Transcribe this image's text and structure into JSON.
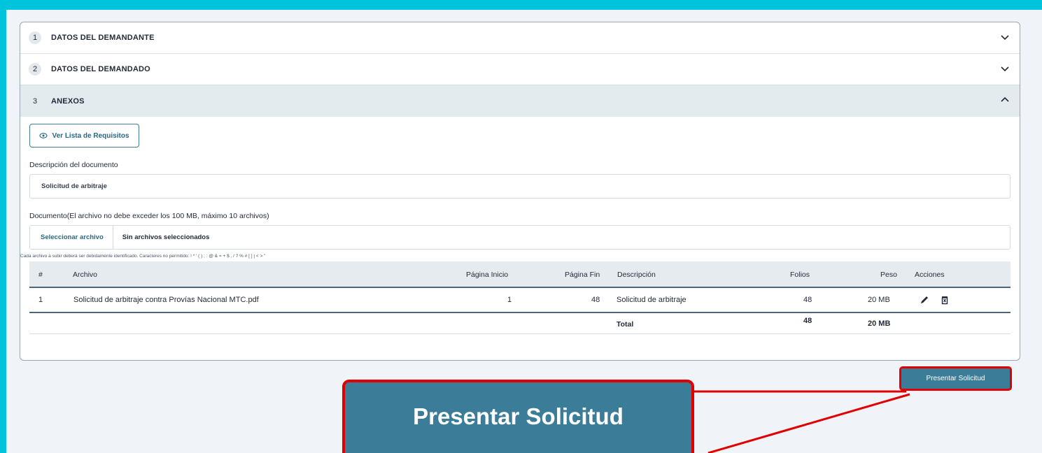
{
  "accordion": [
    {
      "number": "1",
      "title": "DATOS DEL DEMANDANTE",
      "state": "collapsed"
    },
    {
      "number": "2",
      "title": "DATOS DEL DEMANDADO",
      "state": "collapsed"
    },
    {
      "number": "3",
      "title": "ANEXOS",
      "state": "expanded"
    }
  ],
  "anexos": {
    "requisitos_button": "Ver Lista de Requisitos",
    "description_label": "Descripción del documento",
    "description_value": "Solicitud de arbitraje",
    "document_label": "Documento(El archivo no debe exceder los 100 MB, máximo 10 archivos)",
    "select_file_button": "Seleccionar archivo",
    "no_files_text": "Sin archivos seleccionados",
    "hint": "Cada archivo a subir deberá ser debidamente identificado. Caracteres no permitido: ! * ' ( ) ; : @ & = + $ , / ? % # [ ] | < > \""
  },
  "table": {
    "headers": {
      "num": "#",
      "archivo": "Archivo",
      "pagina_inicio": "Página Inicio",
      "pagina_fin": "Página Fin",
      "descripcion": "Descripción",
      "folios": "Folios",
      "peso": "Peso",
      "acciones": "Acciones"
    },
    "rows": [
      {
        "num": "1",
        "archivo": "Solicitud de arbitraje contra Provías Nacional MTC.pdf",
        "pagina_inicio": "1",
        "pagina_fin": "48",
        "descripcion": "Solicitud de arbitraje",
        "folios": "48",
        "peso": "20 MB",
        "actions": [
          "pencil-icon",
          "trash-icon"
        ]
      }
    ],
    "totals": {
      "label": "Total",
      "folios": "48",
      "peso": "20 MB"
    }
  },
  "submit_button": "Presentar Solicitud",
  "callout_label": "Presentar Solicitud",
  "colors": {
    "frame": "#00c4dc",
    "accent": "#3b7d99",
    "highlight": "#e00000",
    "panel_bg": "#f0f3f7"
  }
}
